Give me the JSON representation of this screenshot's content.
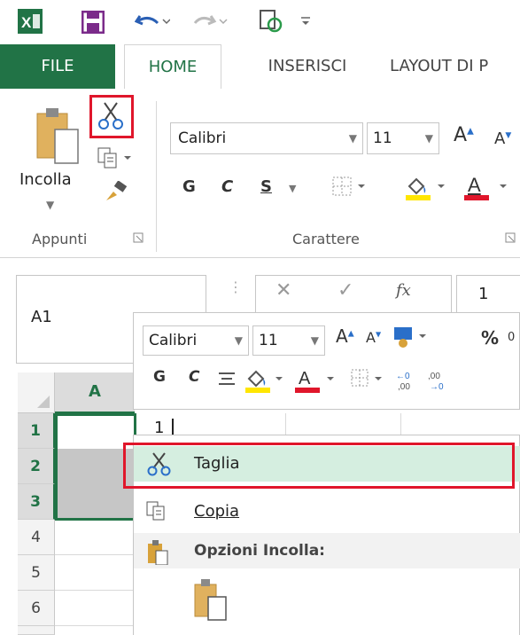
{
  "colors": {
    "accent": "#217346",
    "highlight": "#d5eee0",
    "callout": "#e0162b"
  },
  "qat": {
    "icons": [
      "excel-logo-icon",
      "save-icon",
      "undo-icon",
      "redo-icon",
      "touch-mode-icon",
      "customize-icon"
    ]
  },
  "tabs": [
    "FILE",
    "HOME",
    "INSERISCI",
    "LAYOUT DI P"
  ],
  "ribbon": {
    "clipboard": {
      "paste_label": "Incolla",
      "group_label": "Appunti"
    },
    "font": {
      "name": "Calibri",
      "size": "11",
      "bold": "G",
      "italic": "C",
      "underline": "S",
      "group_label": "Carattere"
    }
  },
  "formula_bar": {
    "name_box": "A1",
    "fx": "fx",
    "value": "1"
  },
  "mini_toolbar": {
    "font": "Calibri",
    "size": "11",
    "bold": "G",
    "italic": "C",
    "percent": "%",
    "zero": "0"
  },
  "grid": {
    "column": "A",
    "rows": [
      "1",
      "2",
      "3",
      "4",
      "5",
      "6"
    ],
    "a1_value": "1"
  },
  "context_menu": {
    "items": [
      {
        "label": "Taglia",
        "icon": "scissors-icon"
      },
      {
        "label": "Copia",
        "icon": "copy-icon"
      }
    ],
    "section": "Opzioni Incolla:"
  }
}
